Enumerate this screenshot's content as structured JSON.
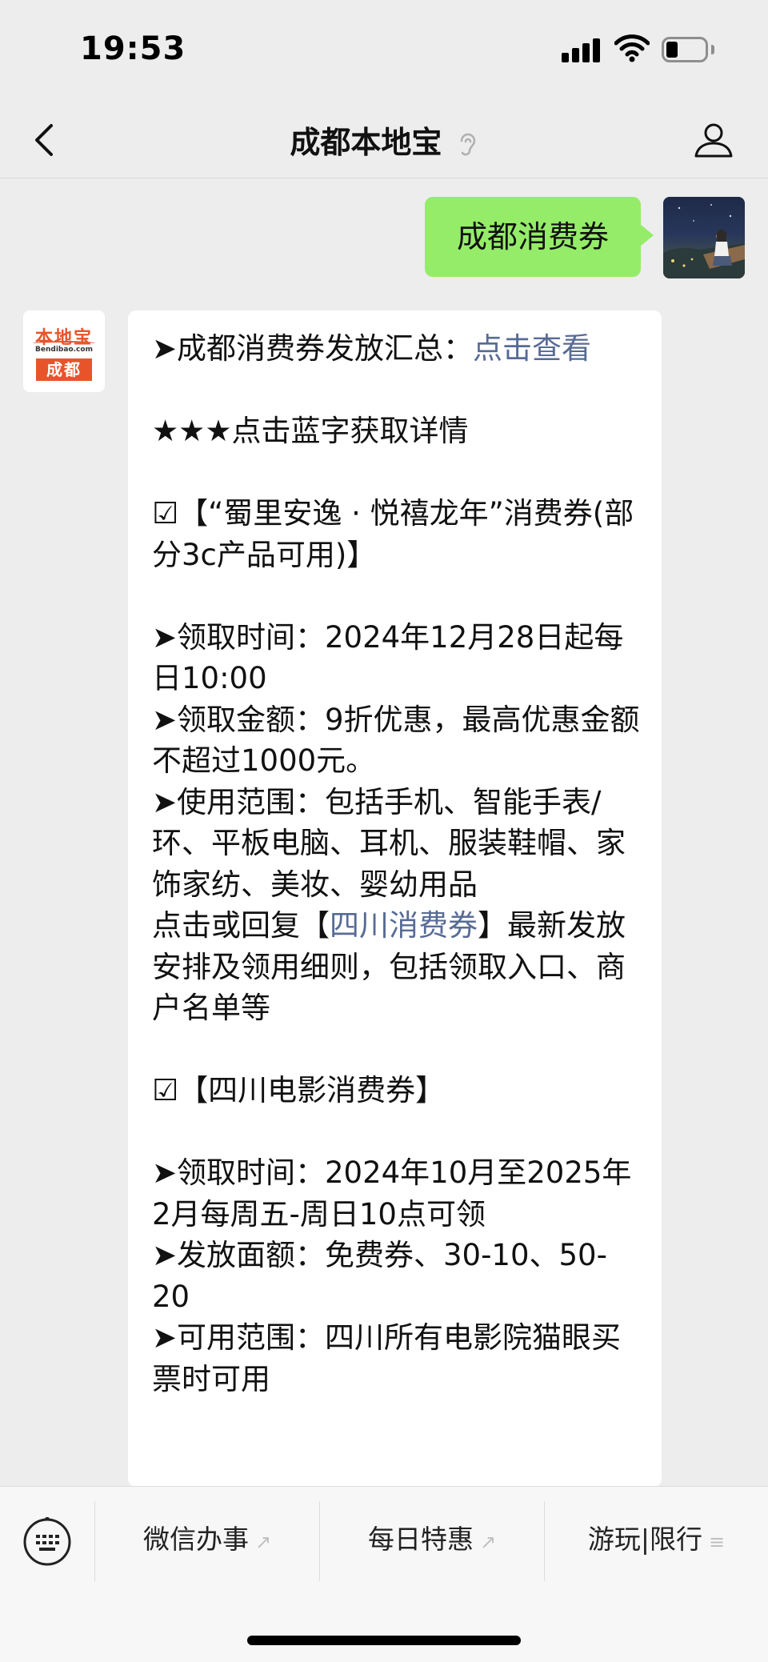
{
  "status_bar": {
    "time": "19:53"
  },
  "nav": {
    "title": "成都本地宝"
  },
  "chat": {
    "sent_message": "成都消费券",
    "bot_avatar": {
      "logo_text": "本地宝",
      "logo_url": "Bendibao.com",
      "logo_city": "成都"
    },
    "reply": {
      "summary_prefix": "➤成都消费券发放汇总：",
      "summary_link": "点击查看",
      "hint": "★★★点击蓝字获取详情",
      "coupon1_title": "☑【“蜀里安逸 · 悦禧龙年”消费券(部分3c产品可用)】",
      "coupon1_time": "➤领取时间：2024年12月28日起每日10:00",
      "coupon1_amount": "➤领取金额：9折优惠，最高优惠金额不超过1000元。",
      "coupon1_scope": "➤使用范围：包括手机、智能手表/环、平板电脑、耳机、服装鞋帽、家饰家纺、美妆、婴幼用品",
      "coupon1_more_prefix": "点击或回复【",
      "coupon1_more_link": "四川消费券",
      "coupon1_more_suffix": "】最新发放安排及领用细则，包括领取入口、商户名单等",
      "coupon2_title": "☑【四川电影消费券】",
      "coupon2_time": "➤领取时间：2024年10月至2025年2月每周五-周日10点可领",
      "coupon2_amount": "➤发放面额：免费券、30-10、50-20",
      "coupon2_scope": "➤可用范围：四川所有电影院猫眼买票时可用"
    }
  },
  "bottom_menu": {
    "items": [
      {
        "label": "微信办事",
        "icon": "link-icon"
      },
      {
        "label": "每日特惠",
        "icon": "link-icon"
      },
      {
        "label": "游玩|限行",
        "icon": "menu-lines-icon"
      }
    ]
  },
  "colors": {
    "sent_bubble": "#95ec69",
    "link": "#576b95",
    "brand": "#e8542a",
    "background": "#ededed"
  }
}
